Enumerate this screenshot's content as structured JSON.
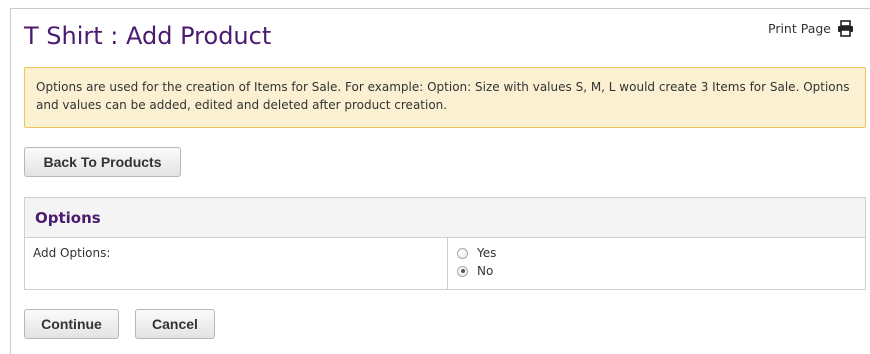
{
  "page": {
    "title": "T Shirt : Add Product",
    "print_label": "Print Page",
    "print_icon": "printer-icon"
  },
  "notice": {
    "text": "Options are used for the creation of Items for Sale. For example: Option: Size with values S, M, L would create 3 Items for Sale. Options and values can be added, edited and deleted after product creation."
  },
  "buttons": {
    "back": "Back To Products",
    "continue": "Continue",
    "cancel": "Cancel"
  },
  "options": {
    "header": "Options",
    "add_options_label": "Add Options:",
    "choices": [
      {
        "label": "Yes",
        "selected": false
      },
      {
        "label": "No",
        "selected": true
      }
    ]
  },
  "colors": {
    "title": "#4b1b6e",
    "notice_bg": "#fbf0d2",
    "notice_border": "#f0c35a"
  }
}
